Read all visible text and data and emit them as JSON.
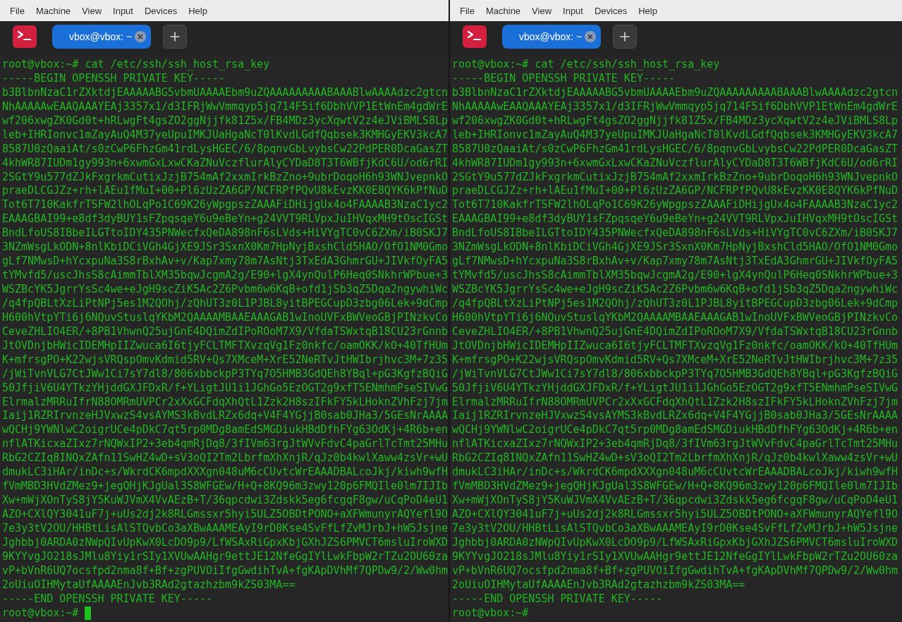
{
  "windows": [
    {
      "menu": [
        "File",
        "Machine",
        "View",
        "Input",
        "Devices",
        "Help"
      ],
      "tabs": [
        {
          "label": "vbox@vbox: ~",
          "selected": true
        }
      ],
      "lines": [
        {
          "kind": "command",
          "prompt": "root@vbox:~#",
          "text": "cat /etc/ssh/ssh_host_rsa_key"
        },
        {
          "kind": "output",
          "text": "-----BEGIN OPENSSH PRIVATE KEY-----"
        },
        {
          "kind": "output",
          "text": "b3BlbnNzaC1rZXktdjEAAAAABG5vbmUAAAAEbm9uZQAAAAAAAAABAAABlwAAAAdzc2gtcn"
        },
        {
          "kind": "output",
          "text": "NhAAAAAwEAAQAAAYEAj3357x1/d3IFRjWwVmmqyp5jq714F5if6DbhVVP1EtWnEm4gdWrE"
        },
        {
          "kind": "output",
          "text": "wf206xwgZK0Gd0t+hRLwgFt4gsZO2ggNjjfk81Z5x/FB4MDz3ycXqwtV2z4eJViBMLS8Lp"
        },
        {
          "kind": "output",
          "text": "leb+IHRIonvc1mZayAuQ4M37yeUpuIMKJUaHgaNcT0lKvdLGdfQqbsek3KMHGyEKV3kcA7"
        },
        {
          "kind": "output",
          "text": "8587U0zQaaiAt/s0zCwP6FhzGm41rdLysHGEC/6/8pqnvGbLvybsCw22PdPER0DcaGasZT"
        },
        {
          "kind": "output",
          "text": "4khWR87IUDm1gy993n+6xwmGxLxwCKaZNuVczflurAlyCYDaD8T3T6WBfjKdC6U/od6rRI"
        },
        {
          "kind": "output",
          "text": "2SGtY9u577dZJkFxgrkmCutixJzjB754mAf2xxmIrkBzZno+9ubrDoqoH6h93WNJvepnkO"
        },
        {
          "kind": "output",
          "text": "praeDLCGJZz+rh+lAEu1fMuI+00+Pl6zUzZA6GP/NCFRPfPQvU8kEvzKK0E8QYK6kPfNuD"
        },
        {
          "kind": "output",
          "text": "Tot6T710KakfrTSFW2lhOLqPo1C69K26yWpgpszZAAAFiDHijgUx4o4FAAAAB3NzaC1yc2"
        },
        {
          "kind": "output",
          "text": "EAAAGBAI99+e8df3dyBUY1sFZpqsqeY6u9eBeYn+g24VVT9RLVpxJuIHVqxMH9tOscIGSt"
        },
        {
          "kind": "output",
          "text": "BndLfoUS8IBbeILGTtoIDY435PNWecfxQeDA898nF6sLVds+HiVYgTC0vC6ZXm/iB0SKJ7"
        },
        {
          "kind": "output",
          "text": "3NZmWsgLkODN+8nlKbiDCiVGh4GjXE9JSr3SxnX0Km7HpNyjBxshCld5HAO/OfO1NM0Gmo"
        },
        {
          "kind": "output",
          "text": "gLf7NMwsD+hYcxpuNa3S8rBxhAv+v/Kap7xmy78m7AsNtj3TxEdA3GhmrGU+JIVkfOyFA5"
        },
        {
          "kind": "output",
          "text": "tYMvfd5/uscJhsS8cAimmTblXM35bqwJcgmA2g/E90+lgX4ynQulP6Heq0SNkhrWPbue+3"
        },
        {
          "kind": "output",
          "text": "WSZBcYK5JgrrYsSc4we+eJgH9scZiK5Ac2Z6Pvbm6w6KqB+ofd1jSb3qZ5Dqa2ngywhiWc"
        },
        {
          "kind": "output",
          "text": "/q4fpQBLtXzLiPtNPj5es1M2QOhj/zQhUT3z0L1PJBL8yitBPEGCupD3zbg06Lek+9dCmp"
        },
        {
          "kind": "output",
          "text": "H600hVtpYTi6j6NQuvStuslqYKbM2QAAAAMBAAEAAAGAB1wInoUVFxBWVeoGBjPINzkvCo"
        },
        {
          "kind": "output",
          "text": "CeveZHLIO4ER/+8PB1VhwnQ25ujGnE4DQimZdIPoROoM7X9/VfdaTSWxtqB18CU23rGnnb"
        },
        {
          "kind": "output",
          "text": "JtOVDnjbHWicIDEMHpIIZwuca6I6tjyFCLTMFTXvzqVg1Fz0nkfc/oamOKK/kO+40TfHUm"
        },
        {
          "kind": "output",
          "text": "K+mfrsgPO+K22wjsVRQspOmvKdmid5RV+Qs7XMceM+XrE52NeRTvJtHWIbrjhvc3M+7z35"
        },
        {
          "kind": "output",
          "text": "/jWiTvnVLG7CtJWw1Ci7sY7dl8/806xbbckpP3TYq7O5HMB3GdQEh8YBql+pG3KgfzBQiG"
        },
        {
          "kind": "output",
          "text": "50JfjiV6U4YTkzYHjddGXJFDxR/f+YLigtJU1i1JGhGo5EzOGT2g9xfT5ENmhmPseSIVwG"
        },
        {
          "kind": "output",
          "text": "ElrmalzMRRuIfrN88OMRmUVPCr2xXxGCFdqXhQtL1Zzk2H8szIFkFY5kLHoknZVhFzj7jm"
        },
        {
          "kind": "output",
          "text": "Iaij1RZRIrvnzeHJVxwzS4vsAYMS3kBvdLRZx6dq+V4F4YGjjB0sab0JHa3/5GEsNrAAAA"
        },
        {
          "kind": "output",
          "text": "wQCHj9YWNlwC2oigrUCe4pDkC7qt5rp0MDg8amEdSMGDiukHBdDfhFYg63OdKj+4R6b+en"
        },
        {
          "kind": "output",
          "text": "nflATKicxaZIxz7rNQWxIP2+3eb4qmRjDq8/3fIVm63rgJtWVvFdvC4paGrlTcTmt25MHu"
        },
        {
          "kind": "output",
          "text": "RbG2CZIq8INQxZAfn11SwHZ4wD+sV3oQI2Tm2LbrfmXhXnjR/qJz0b4kwlXaww4zsVr+wU"
        },
        {
          "kind": "output",
          "text": "dmukLC3iHAr/inDc+s/WkrdCK6mpdXXXgn048uM6cCUvtcWrEAAADBALcoJkj/kiwh9wfH"
        },
        {
          "kind": "output",
          "text": "fVmMBD3HVdZMez9+jegQHjKJgUal3S8WFGEw/H+Q+8KQ96m3zwy120p6FMQIle0lm7IJIb"
        },
        {
          "kind": "output",
          "text": "Xw+mWjXOnTyS8jY5KuWJVmX4VvAEzB+T/36qpcdwi3Zdskk5eg6fcgqF8gw/uCqPoD4eU1"
        },
        {
          "kind": "output",
          "text": "AZO+CXlQY3041uF7j+uUs2dj2k8RLGmssxr5hyi5ULZ5OBDtPONO+aXFWmunyrAQYefl9O"
        },
        {
          "kind": "output",
          "text": "7e3y3tV2OU/HHBtLisAlSTQvbCo3aXBwAAAMEAyI9rD0Kse4SvFfLfZvMJrbJ+hW5Jsjne"
        },
        {
          "kind": "output",
          "text": "Jghbbj0ARDA0zNWpQIvUpKwX0LcDO9p9/LfWSAxRiGpxKbjGXhJZS6PMVCT6msluIroWXD"
        },
        {
          "kind": "output",
          "text": "9KYYvgJO218sJMlu8Yiy1rSIy1XVUwAAHgr9ettJE12NfeGgIYlLwkFbpW2rTZu2OU60za"
        },
        {
          "kind": "output",
          "text": "vP+bVnR6UQ7ocsfpd2nma8f+Bf+zgPUVOiIfgGwdihTvA+fgKApDVhMf7QPDw9/2/Ww0hm"
        },
        {
          "kind": "output",
          "text": "2oUiuOIHMytaUfAAAAEnJvb3RAd2gtazhzbm9kZS03MA=="
        },
        {
          "kind": "output",
          "text": "-----END OPENSSH PRIVATE KEY-----"
        },
        {
          "kind": "prompt",
          "prompt": "root@vbox:~#",
          "cursor": true
        }
      ]
    },
    {
      "menu": [
        "File",
        "Machine",
        "View",
        "Input",
        "Devices",
        "Help"
      ],
      "tabs": [
        {
          "label": "vbox@vbox: ~",
          "selected": true
        }
      ],
      "lines": [
        {
          "kind": "command",
          "prompt": "root@vbox:~#",
          "text": "cat /etc/ssh/ssh_host_rsa_key"
        },
        {
          "kind": "output",
          "text": "-----BEGIN OPENSSH PRIVATE KEY-----"
        },
        {
          "kind": "output",
          "text": "b3BlbnNzaC1rZXktdjEAAAAABG5vbmUAAAAEbm9uZQAAAAAAAAABAAABlwAAAAdzc2gtcn"
        },
        {
          "kind": "output",
          "text": "NhAAAAAwEAAQAAAYEAj3357x1/d3IFRjWwVmmqyp5jq714F5if6DbhVVP1EtWnEm4gdWrE"
        },
        {
          "kind": "output",
          "text": "wf206xwgZK0Gd0t+hRLwgFt4gsZO2ggNjjfk81Z5x/FB4MDz3ycXqwtV2z4eJViBMLS8Lp"
        },
        {
          "kind": "output",
          "text": "leb+IHRIonvc1mZayAuQ4M37yeUpuIMKJUaHgaNcT0lKvdLGdfQqbsek3KMHGyEKV3kcA7"
        },
        {
          "kind": "output",
          "text": "8587U0zQaaiAt/s0zCwP6FhzGm41rdLysHGEC/6/8pqnvGbLvybsCw22PdPER0DcaGasZT"
        },
        {
          "kind": "output",
          "text": "4khWR87IUDm1gy993n+6xwmGxLxwCKaZNuVczflurAlyCYDaD8T3T6WBfjKdC6U/od6rRI"
        },
        {
          "kind": "output",
          "text": "2SGtY9u577dZJkFxgrkmCutixJzjB754mAf2xxmIrkBzZno+9ubrDoqoH6h93WNJvepnkO"
        },
        {
          "kind": "output",
          "text": "praeDLCGJZz+rh+lAEu1fMuI+00+Pl6zUzZA6GP/NCFRPfPQvU8kEvzKK0E8QYK6kPfNuD"
        },
        {
          "kind": "output",
          "text": "Tot6T710KakfrTSFW2lhOLqPo1C69K26yWpgpszZAAAFiDHijgUx4o4FAAAAB3NzaC1yc2"
        },
        {
          "kind": "output",
          "text": "EAAAGBAI99+e8df3dyBUY1sFZpqsqeY6u9eBeYn+g24VVT9RLVpxJuIHVqxMH9tOscIGSt"
        },
        {
          "kind": "output",
          "text": "BndLfoUS8IBbeILGTtoIDY435PNWecfxQeDA898nF6sLVds+HiVYgTC0vC6ZXm/iB0SKJ7"
        },
        {
          "kind": "output",
          "text": "3NZmWsgLkODN+8nlKbiDCiVGh4GjXE9JSr3SxnX0Km7HpNyjBxshCld5HAO/OfO1NM0Gmo"
        },
        {
          "kind": "output",
          "text": "gLf7NMwsD+hYcxpuNa3S8rBxhAv+v/Kap7xmy78m7AsNtj3TxEdA3GhmrGU+JIVkfOyFA5"
        },
        {
          "kind": "output",
          "text": "tYMvfd5/uscJhsS8cAimmTblXM35bqwJcgmA2g/E90+lgX4ynQulP6Heq0SNkhrWPbue+3"
        },
        {
          "kind": "output",
          "text": "WSZBcYK5JgrrYsSc4we+eJgH9scZiK5Ac2Z6Pvbm6w6KqB+ofd1jSb3qZ5Dqa2ngywhiWc"
        },
        {
          "kind": "output",
          "text": "/q4fpQBLtXzLiPtNPj5es1M2QOhj/zQhUT3z0L1PJBL8yitBPEGCupD3zbg06Lek+9dCmp"
        },
        {
          "kind": "output",
          "text": "H600hVtpYTi6j6NQuvStuslqYKbM2QAAAAMBAAEAAAGAB1wInoUVFxBWVeoGBjPINzkvCo"
        },
        {
          "kind": "output",
          "text": "CeveZHLIO4ER/+8PB1VhwnQ25ujGnE4DQimZdIPoROoM7X9/VfdaTSWxtqB18CU23rGnnb"
        },
        {
          "kind": "output",
          "text": "JtOVDnjbHWicIDEMHpIIZwuca6I6tjyFCLTMFTXvzqVg1Fz0nkfc/oamOKK/kO+40TfHUm"
        },
        {
          "kind": "output",
          "text": "K+mfrsgPO+K22wjsVRQspOmvKdmid5RV+Qs7XMceM+XrE52NeRTvJtHWIbrjhvc3M+7z35"
        },
        {
          "kind": "output",
          "text": "/jWiTvnVLG7CtJWw1Ci7sY7dl8/806xbbckpP3TYq7O5HMB3GdQEh8YBql+pG3KgfzBQiG"
        },
        {
          "kind": "output",
          "text": "50JfjiV6U4YTkzYHjddGXJFDxR/f+YLigtJU1i1JGhGo5EzOGT2g9xfT5ENmhmPseSIVwG"
        },
        {
          "kind": "output",
          "text": "ElrmalzMRRuIfrN88OMRmUVPCr2xXxGCFdqXhQtL1Zzk2H8szIFkFY5kLHoknZVhFzj7jm"
        },
        {
          "kind": "output",
          "text": "Iaij1RZRIrvnzeHJVxwzS4vsAYMS3kBvdLRZx6dq+V4F4YGjjB0sab0JHa3/5GEsNrAAAA"
        },
        {
          "kind": "output",
          "text": "wQCHj9YWNlwC2oigrUCe4pDkC7qt5rp0MDg8amEdSMGDiukHBdDfhFYg63OdKj+4R6b+en"
        },
        {
          "kind": "output",
          "text": "nflATKicxaZIxz7rNQWxIP2+3eb4qmRjDq8/3fIVm63rgJtWVvFdvC4paGrlTcTmt25MHu"
        },
        {
          "kind": "output",
          "text": "RbG2CZIq8INQxZAfn11SwHZ4wD+sV3oQI2Tm2LbrfmXhXnjR/qJz0b4kwlXaww4zsVr+wU"
        },
        {
          "kind": "output",
          "text": "dmukLC3iHAr/inDc+s/WkrdCK6mpdXXXgn048uM6cCUvtcWrEAAADBALcoJkj/kiwh9wfH"
        },
        {
          "kind": "output",
          "text": "fVmMBD3HVdZMez9+jegQHjKJgUal3S8WFGEw/H+Q+8KQ96m3zwy120p6FMQIle0lm7IJIb"
        },
        {
          "kind": "output",
          "text": "Xw+mWjXOnTyS8jY5KuWJVmX4VvAEzB+T/36qpcdwi3Zdskk5eg6fcgqF8gw/uCqPoD4eU1"
        },
        {
          "kind": "output",
          "text": "AZO+CXlQY3041uF7j+uUs2dj2k8RLGmssxr5hyi5ULZ5OBDtPONO+aXFWmunyrAQYefl9O"
        },
        {
          "kind": "output",
          "text": "7e3y3tV2OU/HHBtLisAlSTQvbCo3aXBwAAAMEAyI9rD0Kse4SvFfLfZvMJrbJ+hW5Jsjne"
        },
        {
          "kind": "output",
          "text": "Jghbbj0ARDA0zNWpQIvUpKwX0LcDO9p9/LfWSAxRiGpxKbjGXhJZS6PMVCT6msluIroWXD"
        },
        {
          "kind": "output",
          "text": "9KYYvgJO218sJMlu8Yiy1rSIy1XVUwAAHgr9ettJE12NfeGgIYlLwkFbpW2rTZu2OU60za"
        },
        {
          "kind": "output",
          "text": "vP+bVnR6UQ7ocsfpd2nma8f+Bf+zgPUVOiIfgGwdihTvA+fgKApDVhMf7QPDw9/2/Ww0hm"
        },
        {
          "kind": "output",
          "text": "2oUiuOIHMytaUfAAAAEnJvb3RAd2gtazhzbm9kZS03MA=="
        },
        {
          "kind": "output",
          "text": "-----END OPENSSH PRIVATE KEY-----"
        },
        {
          "kind": "prompt",
          "prompt": "root@vbox:~#",
          "cursor": false
        }
      ]
    }
  ]
}
